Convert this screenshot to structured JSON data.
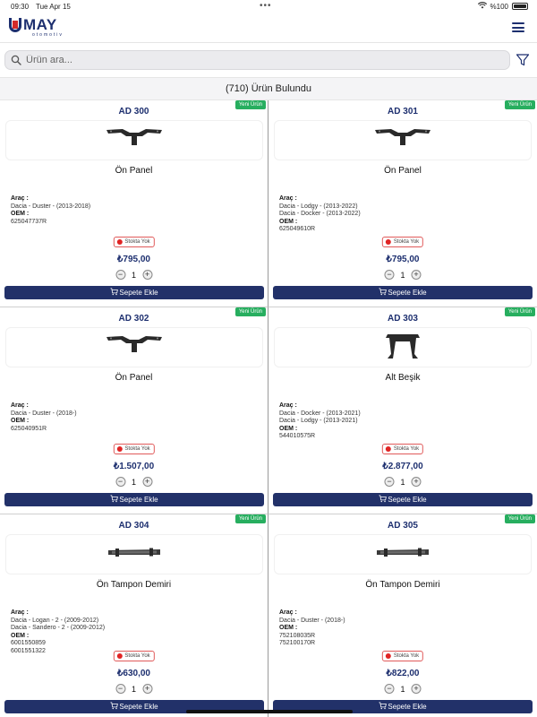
{
  "status_bar": {
    "time": "09:30",
    "date": "Tue Apr 15",
    "battery": "%100"
  },
  "header": {
    "logo_text": "MAY",
    "logo_sub": "otomotiv"
  },
  "search": {
    "placeholder": "Ürün ara..."
  },
  "results": {
    "text": "(710) Ürün Bulundu"
  },
  "labels": {
    "new_badge": "Yeni Ürün",
    "vehicle": "Araç :",
    "oem": "OEM :",
    "out_of_stock": "Stokta Yok",
    "add_to_cart": "Sepete Ekle",
    "minus": "−",
    "plus": "+"
  },
  "products": [
    {
      "code": "AD 300",
      "name": "Ön Panel",
      "vehicles": [
        "Dacia - Duster - (2013-2018)"
      ],
      "oem": [
        "625047737R"
      ],
      "price": "₺795,00",
      "qty": "1",
      "icon": "front-panel-part-image"
    },
    {
      "code": "AD 301",
      "name": "Ön Panel",
      "vehicles": [
        "Dacia - Lodgy - (2013-2022)",
        "Dacia - Docker - (2013-2022)"
      ],
      "oem": [
        "625049610R"
      ],
      "price": "₺795,00",
      "qty": "1",
      "icon": "front-panel-part-image"
    },
    {
      "code": "AD 302",
      "name": "Ön Panel",
      "vehicles": [
        "Dacia - Duster - (2018-)"
      ],
      "oem": [
        "625040951R"
      ],
      "price": "₺1.507,00",
      "qty": "1",
      "icon": "front-panel-part-image"
    },
    {
      "code": "AD 303",
      "name": "Alt Beşik",
      "vehicles": [
        "Dacia - Docker - (2013-2021)",
        "Dacia - Lodgy - (2013-2021)"
      ],
      "oem": [
        "544010575R"
      ],
      "price": "₺2.877,00",
      "qty": "1",
      "icon": "subframe-part-image"
    },
    {
      "code": "AD 304",
      "name": "Ön Tampon Demiri",
      "vehicles": [
        "Dacia - Logan - 2 - (2009-2012)",
        "Dacia - Sandero - 2 - (2009-2012)"
      ],
      "oem": [
        "6001550859",
        "6001551322"
      ],
      "price": "₺630,00",
      "qty": "1",
      "icon": "bumper-bar-part-image"
    },
    {
      "code": "AD 305",
      "name": "Ön Tampon Demiri",
      "vehicles": [
        "Dacia - Duster - (2018-)"
      ],
      "oem": [
        "752108035R",
        "752100170R"
      ],
      "price": "₺822,00",
      "qty": "1",
      "icon": "bumper-bar-part-image"
    }
  ]
}
